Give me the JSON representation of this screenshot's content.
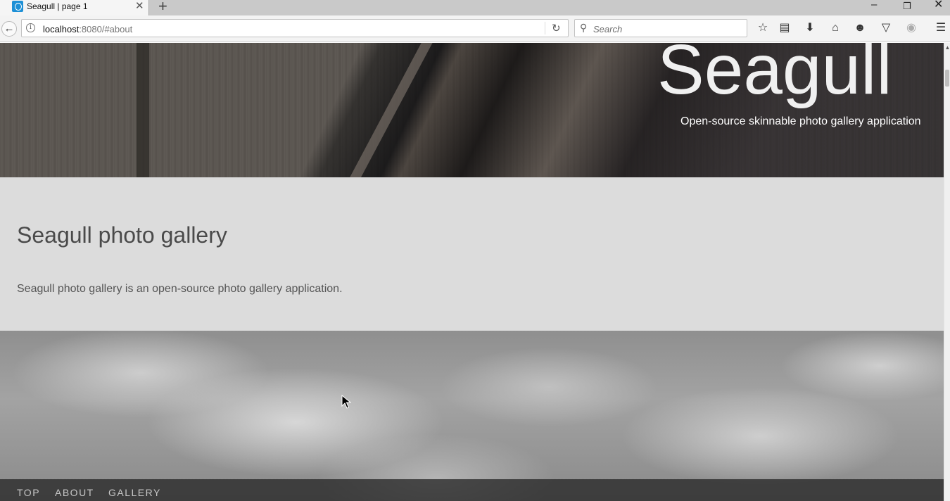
{
  "browser": {
    "tab_title": "Seagull | page 1",
    "new_tab_icon": "+",
    "url_host": "localhost",
    "url_rest": ":8080/#about",
    "search_placeholder": "Search",
    "window_controls": {
      "minimize": "–",
      "maximize": "❐",
      "close": "✕"
    },
    "toolbar_icons": [
      "star-icon",
      "reading-list-icon",
      "download-icon",
      "home-icon",
      "chat-icon",
      "pocket-icon",
      "sync-icon",
      "menu-icon"
    ]
  },
  "hero": {
    "title": "Seagull",
    "subtitle": "Open-source skinnable photo gallery application"
  },
  "about": {
    "title": "Seagull photo gallery",
    "text": "Seagull photo gallery is an open-source photo gallery application."
  },
  "footer_nav": {
    "items": [
      {
        "label": "TOP"
      },
      {
        "label": "ABOUT"
      },
      {
        "label": "GALLERY"
      }
    ]
  }
}
